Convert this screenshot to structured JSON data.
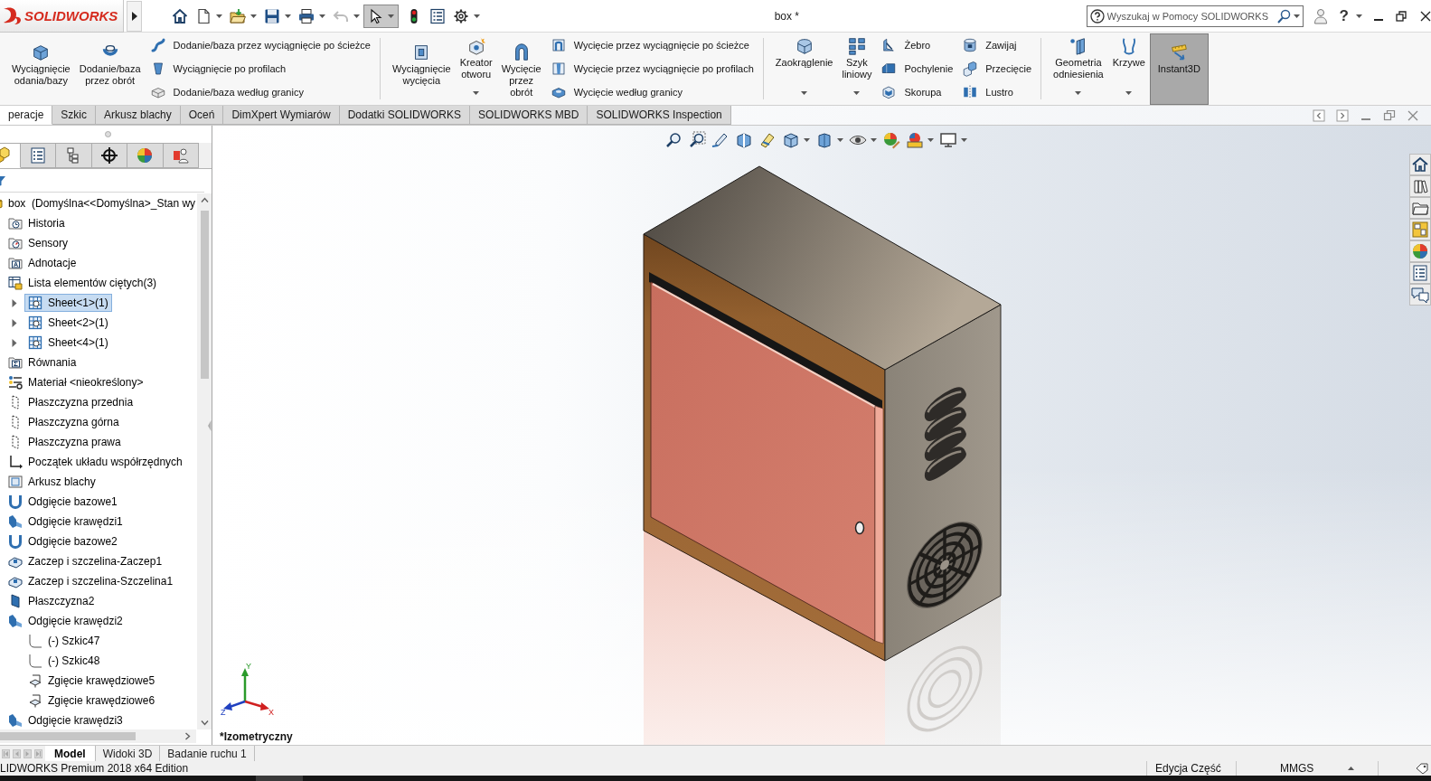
{
  "title_bar": {
    "logo": "SOLIDWORKS",
    "quick_access": [
      {
        "kind": "home",
        "dropdown": false,
        "disabled": false,
        "pressed": false
      },
      {
        "kind": "new",
        "dropdown": true,
        "disabled": false,
        "pressed": false
      },
      {
        "kind": "open",
        "dropdown": true,
        "disabled": false,
        "pressed": false
      },
      {
        "kind": "save",
        "dropdown": true,
        "disabled": false,
        "pressed": false
      },
      {
        "kind": "print",
        "dropdown": true,
        "disabled": false,
        "pressed": false
      },
      {
        "kind": "undo",
        "dropdown": true,
        "disabled": true,
        "pressed": false
      },
      {
        "kind": "select",
        "dropdown": true,
        "disabled": false,
        "pressed": true
      },
      {
        "kind": "rebuild",
        "dropdown": false,
        "disabled": false,
        "pressed": false
      },
      {
        "kind": "file-properties",
        "dropdown": false,
        "disabled": false,
        "pressed": false
      },
      {
        "kind": "options",
        "dropdown": true,
        "disabled": false,
        "pressed": false
      }
    ],
    "title": "box *",
    "search": {
      "placeholder": "Wyszukaj w Pomocy SOLIDWORKS"
    },
    "help": "?"
  },
  "ribbon": {
    "groups": [
      {
        "items": [
          {
            "kind": "large",
            "label": "Wyciągnięcie\nodania/bazy",
            "dropdown": false,
            "pressed": false
          },
          {
            "kind": "large",
            "label": "Dodanie/baza\nprzez obrót",
            "dropdown": false,
            "pressed": false
          },
          {
            "kind": "column",
            "items": [
              "Dodanie/baza przez wyciągnięcie po ścieżce",
              "Wyciągnięcie po profilach",
              "Dodanie/baza według granicy"
            ]
          }
        ]
      },
      {
        "items": [
          {
            "kind": "large",
            "label": "Wyciągnięcie\nwycięcia",
            "dropdown": false,
            "pressed": false
          },
          {
            "kind": "large",
            "label": "Kreator\notworu",
            "dropdown": true,
            "pressed": false
          },
          {
            "kind": "large",
            "label": "Wycięcie\nprzez\nobrót",
            "dropdown": false,
            "pressed": false
          },
          {
            "kind": "column",
            "items": [
              "Wycięcie przez wyciągnięcie po ścieżce",
              "Wycięcie przez wyciągnięcie po profilach",
              "Wycięcie według granicy"
            ]
          }
        ]
      },
      {
        "items": [
          {
            "kind": "large",
            "label": "Zaokrąglenie",
            "dropdown": true,
            "pressed": false
          },
          {
            "kind": "large",
            "label": "Szyk\nliniowy",
            "dropdown": true,
            "pressed": false
          },
          {
            "kind": "column",
            "items": [
              "Żebro",
              "Pochylenie",
              "Skorupa"
            ]
          },
          {
            "kind": "column",
            "items": [
              "Zawijaj",
              "Przecięcie",
              "Lustro"
            ]
          }
        ]
      },
      {
        "items": [
          {
            "kind": "large",
            "label": "Geometria\nodniesienia",
            "dropdown": true,
            "pressed": false
          },
          {
            "kind": "large",
            "label": "Krzywe",
            "dropdown": true,
            "pressed": false
          },
          {
            "kind": "large",
            "label": "Instant3D",
            "dropdown": false,
            "pressed": true
          }
        ]
      }
    ]
  },
  "command_tabs": [
    {
      "label": "peracje",
      "selected": true
    },
    {
      "label": "Szkic",
      "selected": false
    },
    {
      "label": "Arkusz blachy",
      "selected": false
    },
    {
      "label": "Oceń",
      "selected": false
    },
    {
      "label": "DimXpert Wymiarów",
      "selected": false
    },
    {
      "label": "Dodatki SOLIDWORKS",
      "selected": false
    },
    {
      "label": "SOLIDWORKS MBD",
      "selected": false
    },
    {
      "label": "SOLIDWORKS Inspection",
      "selected": false
    }
  ],
  "feature_manager": {
    "tabs": [
      {
        "kind": "feature-tree",
        "selected": true
      },
      {
        "kind": "property-manager",
        "selected": false
      },
      {
        "kind": "configuration-manager",
        "selected": false
      },
      {
        "kind": "dimxpert-manager",
        "selected": false
      },
      {
        "kind": "display-manager",
        "selected": false
      },
      {
        "kind": "people",
        "selected": false
      }
    ],
    "tree": {
      "label": "box  (Domyślna<<Domyślna>_Stan wy",
      "kind": "part",
      "selected": false,
      "children": [
        {
          "label": "Historia",
          "kind": "history",
          "selected": false
        },
        {
          "label": "Sensory",
          "kind": "sensors",
          "selected": false
        },
        {
          "label": "Adnotacje",
          "kind": "annotations",
          "selected": false
        },
        {
          "label": "Lista elementów ciętych(3)",
          "kind": "cut-list",
          "selected": false,
          "children": [
            {
              "label": "Sheet<1>(1)",
              "kind": "sheet-body",
              "selected": true,
              "expanded": false
            },
            {
              "label": "Sheet<2>(1)",
              "kind": "sheet-body",
              "selected": false,
              "expanded": false
            },
            {
              "label": "Sheet<4>(1)",
              "kind": "sheet-body",
              "selected": false,
              "expanded": false
            }
          ]
        },
        {
          "label": "Równania",
          "kind": "equations",
          "selected": false
        },
        {
          "label": "Materiał <nieokreślony>",
          "kind": "material",
          "selected": false
        },
        {
          "label": "Płaszczyzna przednia",
          "kind": "plane",
          "selected": false
        },
        {
          "label": "Płaszczyzna górna",
          "kind": "plane",
          "selected": false
        },
        {
          "label": "Płaszczyzna prawa",
          "kind": "plane",
          "selected": false
        },
        {
          "label": "Początek układu współrzędnych",
          "kind": "origin",
          "selected": false
        },
        {
          "label": "Arkusz blachy",
          "kind": "sheet-metal",
          "selected": false
        },
        {
          "label": "Odgięcie bazowe1",
          "kind": "base-flange",
          "selected": false
        },
        {
          "label": "Odgięcie krawędzi1",
          "kind": "edge-flange",
          "selected": false
        },
        {
          "label": "Odgięcie bazowe2",
          "kind": "base-flange",
          "selected": false
        },
        {
          "label": "Zaczep i szczelina-Zaczep1",
          "kind": "tab-slot",
          "selected": false
        },
        {
          "label": "Zaczep i szczelina-Szczelina1",
          "kind": "tab-slot",
          "selected": false
        },
        {
          "label": "Płaszczyzna2",
          "kind": "ref-plane",
          "selected": false
        },
        {
          "label": "Odgięcie krawędzi2",
          "kind": "edge-flange",
          "selected": false,
          "children": [
            {
              "label": "(-) Szkic47",
              "kind": "sketch",
              "selected": false
            },
            {
              "label": "(-) Szkic48",
              "kind": "sketch",
              "selected": false
            },
            {
              "label": "Zgięcie krawędziowe5",
              "kind": "bend",
              "selected": false
            },
            {
              "label": "Zgięcie krawędziowe6",
              "kind": "bend",
              "selected": false
            }
          ]
        },
        {
          "label": "Odgięcie krawędzi3",
          "kind": "edge-flange",
          "selected": false
        }
      ]
    }
  },
  "viewport": {
    "heads_up_toolbar": [
      {
        "kind": "zoom-to-fit",
        "dropdown": false
      },
      {
        "kind": "zoom-to-area",
        "dropdown": false
      },
      {
        "kind": "previous-view",
        "dropdown": false
      },
      {
        "kind": "section-view",
        "dropdown": false
      },
      {
        "kind": "dynamic-annotation",
        "dropdown": false
      },
      {
        "kind": "view-orientation",
        "dropdown": true
      },
      {
        "kind": "display-style",
        "dropdown": true
      },
      {
        "kind": "hide-show",
        "dropdown": true
      },
      {
        "kind": "edit-appearance",
        "dropdown": false
      },
      {
        "kind": "apply-scene",
        "dropdown": true
      },
      {
        "kind": "view-settings",
        "dropdown": true
      }
    ],
    "task_pane": [
      {
        "kind": "home"
      },
      {
        "kind": "design-library"
      },
      {
        "kind": "file-explorer"
      },
      {
        "kind": "view-palette"
      },
      {
        "kind": "appearances"
      },
      {
        "kind": "custom-properties"
      },
      {
        "kind": "forum"
      }
    ],
    "triad": {
      "x": "X",
      "y": "Y",
      "z": "Z"
    },
    "view_label": "*Izometryczny"
  },
  "bottom_tabs": [
    {
      "label": "Model",
      "selected": true
    },
    {
      "label": "Widoki 3D",
      "selected": false
    },
    {
      "label": "Badanie ruchu 1",
      "selected": false
    }
  ],
  "status_bar": {
    "product": "LIDWORKS Premium 2018 x64 Edition",
    "mode": "Edycja Część",
    "units": "MMGS"
  }
}
